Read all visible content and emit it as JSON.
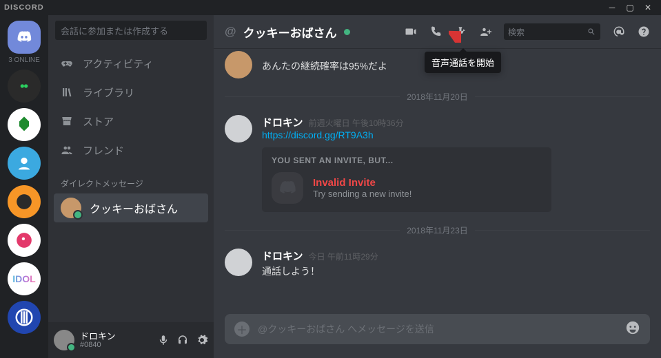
{
  "app": {
    "brand": "DISCORD"
  },
  "guilds": {
    "online_label": "3 ONLINE"
  },
  "sidebar": {
    "search_placeholder": "会話に参加または作成する",
    "nav": [
      {
        "label": "アクティビティ"
      },
      {
        "label": "ライブラリ"
      },
      {
        "label": "ストア"
      },
      {
        "label": "フレンド"
      }
    ],
    "dm_section": "ダイレクトメッセージ",
    "dms": [
      {
        "name": "クッキーおばさん"
      }
    ]
  },
  "user": {
    "name": "ドロキン",
    "tag": "#0840"
  },
  "header": {
    "at": "@",
    "channel": "クッキーおばさん",
    "search_placeholder": "検索",
    "tooltip": "音声通話を開始"
  },
  "chat": {
    "msg1": {
      "text": "あんたの継続確率は95%だよ"
    },
    "divider1": "2018年11月20日",
    "msg2": {
      "user": "ドロキン",
      "time": "前週火曜日 午後10時36分",
      "link": "https://discord.gg/RT9A3h"
    },
    "invite": {
      "label": "YOU SENT AN INVITE, BUT...",
      "title": "Invalid Invite",
      "sub": "Try sending a new invite!"
    },
    "divider2": "2018年11月23日",
    "msg3": {
      "user": "ドロキン",
      "time": "今日 午前11時29分",
      "text": "通話しよう！"
    }
  },
  "input": {
    "placeholder": "@クッキーおばさん へメッセージを送信"
  }
}
